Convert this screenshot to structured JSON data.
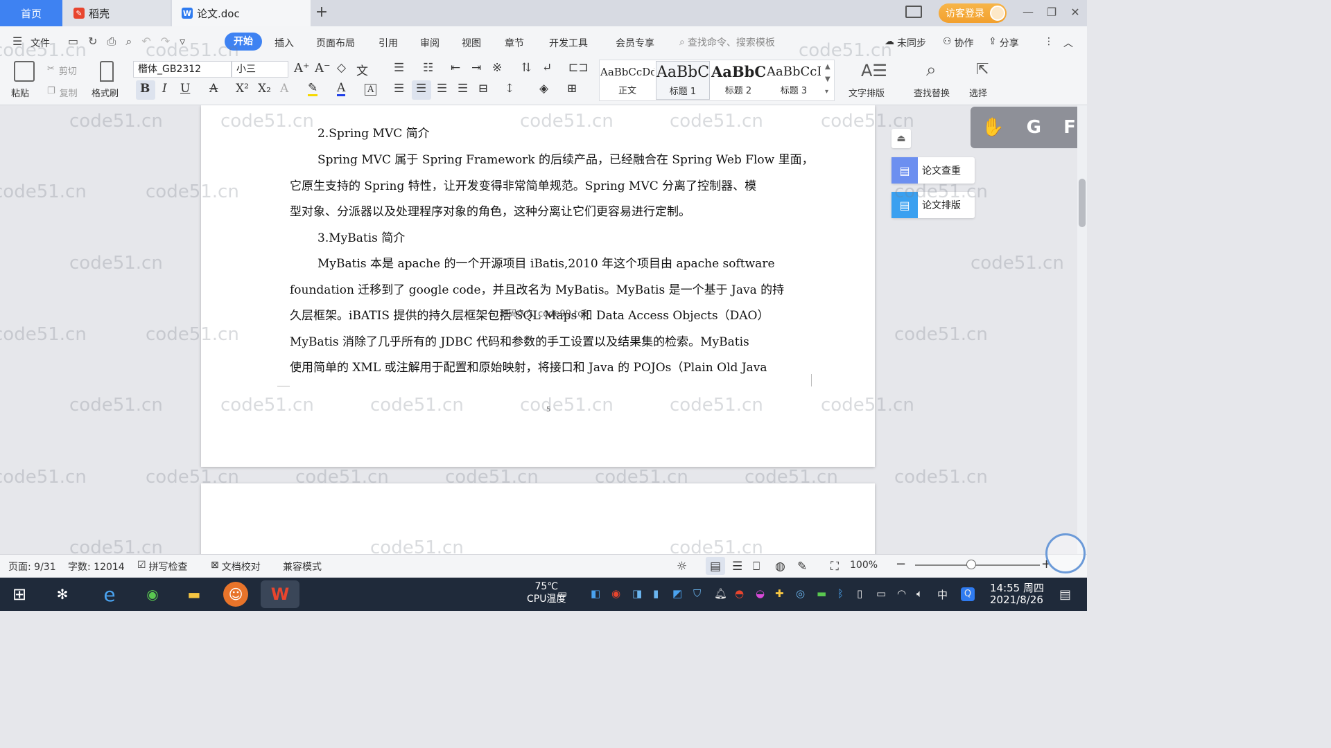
{
  "tabs": {
    "home": "首页",
    "daoke": "稻壳",
    "doc": "论文.doc",
    "add": "+"
  },
  "titlebar": {
    "login": "访客登录"
  },
  "menu": {
    "file": "文件",
    "items": [
      "开始",
      "插入",
      "页面布局",
      "引用",
      "审阅",
      "视图",
      "章节",
      "开发工具",
      "会员专享"
    ],
    "search_placeholder": "查找命令、搜索模板",
    "sync": "未同步",
    "collab": "协作",
    "share": "分享"
  },
  "ribbon": {
    "paste": "粘贴",
    "cut": "剪切",
    "copy": "复制",
    "format_painter": "格式刷",
    "font_name": "楷体_GB2312",
    "font_size": "小三",
    "styles": [
      {
        "sample": "AaBbCcDd",
        "name": "正文"
      },
      {
        "sample": "AaBbC",
        "name": "标题 1"
      },
      {
        "sample": "AaBbC",
        "name": "标题 2"
      },
      {
        "sample": "AaBbCcI",
        "name": "标题 3"
      }
    ],
    "text_layout": "文字排版",
    "find_replace": "查找替换",
    "select": "选择"
  },
  "side_panel": {
    "check": "论文查重",
    "layout": "论文排版"
  },
  "float_toolbar": {
    "g": "G",
    "f": "F"
  },
  "document": {
    "heading_spring": "2.Spring MVC 简介",
    "p1": [
      "Spring MVC 属于 Spring Framework 的后续产品，已经融合在 Spring Web Flow 里面，",
      "它原生支持的 Spring 特性，让开发变得非常简单规范。Spring MVC 分离了控制器、模",
      "型对象、分派器以及处理程序对象的角色，这种分离让它们更容易进行定制。"
    ],
    "heading_mybatis": "3.MyBatis 简介",
    "p2": [
      "MyBatis 本是 apache 的一个开源项目 iBatis,2010 年这个项目由 apache software",
      "foundation 迁移到了 google code，并且改名为 MyBatis。MyBatis 是一个基于 Java 的持",
      "久层框架。iBATIS 提供的持久层框架包括 SQL Maps 和 Data Access Objects（DAO）",
      "MyBatis 消除了几乎所有的 JDBC 代码和参数的手工设置以及结果集的检索。MyBatis",
      "使用简单的 XML 或注解用于配置和原始映射，将接口和 Java 的 POJOs（Plain Old Java"
    ],
    "overlay": "源码久久 code99.top",
    "page_number": "5"
  },
  "statusbar": {
    "page": "页面: 9/31",
    "words": "字数: 12014",
    "spell": "拼写检查",
    "proof": "文档校对",
    "compat": "兼容模式",
    "zoom": "100%"
  },
  "taskbar": {
    "temp": "75℃",
    "temp_label": "CPU温度",
    "ime": "中",
    "time": "14:55 周四",
    "date": "2021/8/26"
  },
  "watermark": "code51.cn",
  "colors": {
    "accent": "#3e82f2",
    "login": "#f2a02e"
  }
}
